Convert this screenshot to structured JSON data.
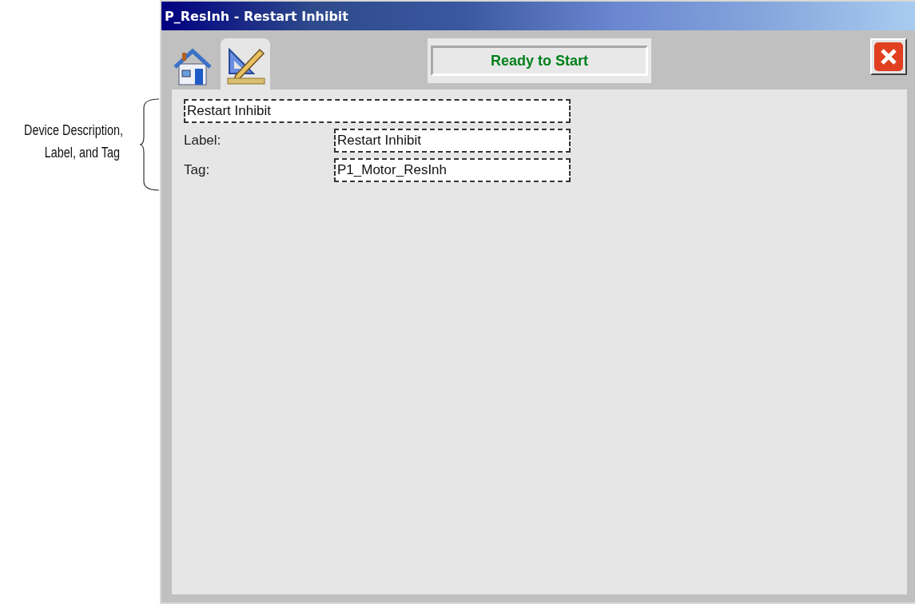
{
  "callout": {
    "text": "Device Description,\nLabel, and Tag"
  },
  "window": {
    "title": "P_ResInh - Restart Inhibit"
  },
  "tabs": [
    {
      "kind": "home",
      "selected": false
    },
    {
      "kind": "configuration",
      "selected": true
    }
  ],
  "status": {
    "text": "Ready to Start"
  },
  "fields": [
    {
      "kind": "description",
      "value": "Restart Inhibit"
    },
    {
      "kind": "labeled",
      "label": "Label:",
      "value": "Restart Inhibit"
    },
    {
      "kind": "labeled",
      "label": "Tag:",
      "value": "P1_Motor_ResInh"
    }
  ]
}
